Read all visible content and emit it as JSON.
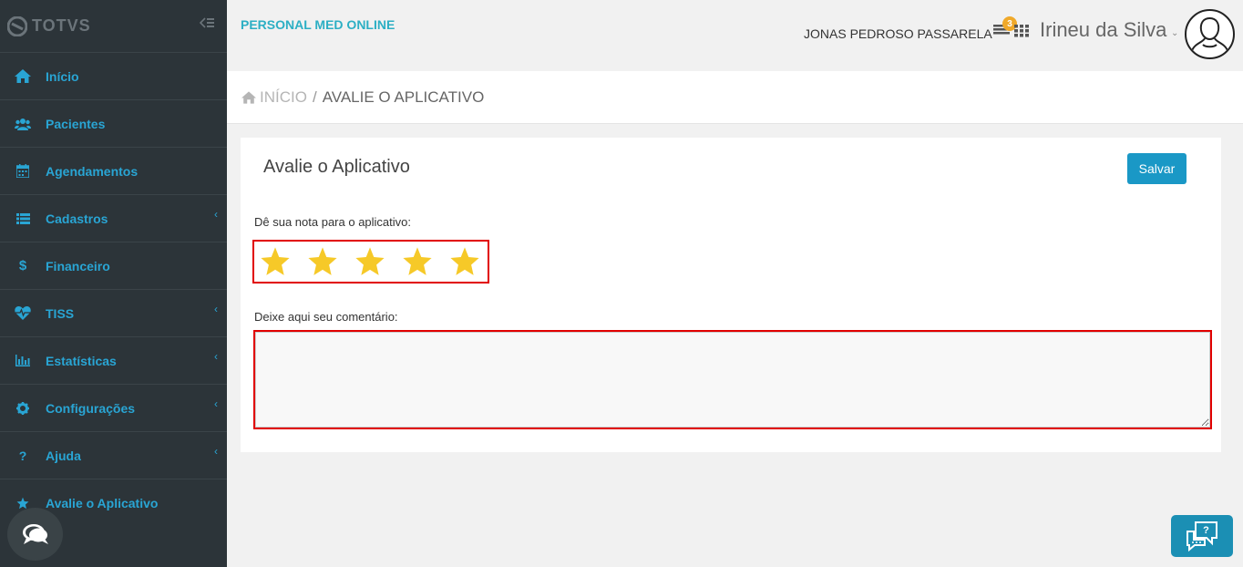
{
  "brand": {
    "name": "TOTVS"
  },
  "sidebar": {
    "items": [
      {
        "label": "Início",
        "icon": "home-icon",
        "has_submenu": false
      },
      {
        "label": "Pacientes",
        "icon": "users-icon",
        "has_submenu": false
      },
      {
        "label": "Agendamentos",
        "icon": "calendar-icon",
        "has_submenu": false
      },
      {
        "label": "Cadastros",
        "icon": "list-icon",
        "has_submenu": true
      },
      {
        "label": "Financeiro",
        "icon": "dollar-icon",
        "has_submenu": false
      },
      {
        "label": "TISS",
        "icon": "heartbeat-icon",
        "has_submenu": true
      },
      {
        "label": "Estatísticas",
        "icon": "bar-chart-icon",
        "has_submenu": true
      },
      {
        "label": "Configurações",
        "icon": "gear-icon",
        "has_submenu": true
      },
      {
        "label": "Ajuda",
        "icon": "question-icon",
        "has_submenu": true
      },
      {
        "label": "Avalie o Aplicativo",
        "icon": "star-icon",
        "has_submenu": false,
        "active": true
      }
    ]
  },
  "header": {
    "app_name": "PERSONAL MED ONLINE",
    "tenant_name": "JONAS PEDROSO PASSARELA",
    "notification_count": "3",
    "user_name": "Irineu da Silva"
  },
  "breadcrumb": {
    "home": "INÍCIO",
    "separator": "/",
    "current": "AVALIE O APLICATIVO"
  },
  "form": {
    "title": "Avalie o Aplicativo",
    "save_label": "Salvar",
    "rating_label": "Dê sua nota para o aplicativo:",
    "rating_value": 5,
    "rating_max": 5,
    "comment_label": "Deixe aqui seu comentário:",
    "comment_value": "",
    "comment_placeholder": ""
  },
  "colors": {
    "sidebar_bg": "#2c3439",
    "accent": "#29a5d4",
    "brand_teal": "#2cafc4",
    "primary_button": "#1a98c6",
    "star": "#f6c928",
    "highlight_border": "#e10000",
    "badge": "#f0a92a"
  }
}
